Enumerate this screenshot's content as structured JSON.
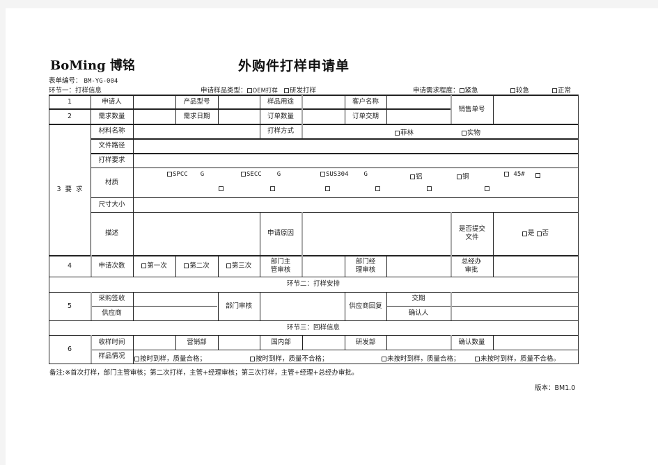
{
  "header": {
    "brand": "BoMing 博铭",
    "title": "外购件打样申请单",
    "form_no_label": "表单编号：",
    "form_no": "BM-YG-004",
    "section1": "环节一：打样信息",
    "sample_type_label": "申请样品类型：",
    "sample_type_options": [
      "OEM打样",
      "研发打样"
    ],
    "urgency_label": "申请需求程度：",
    "urgency_options": [
      "紧急",
      "较急",
      "正常"
    ]
  },
  "rows": {
    "r1": {
      "no": "1",
      "applicant": "申请人",
      "product_model": "产品型号",
      "sample_use": "样品用途",
      "customer_name": "客户名称",
      "sales_no": "销售单号"
    },
    "r2": {
      "no": "2",
      "req_qty": "需求数量",
      "req_date": "需求日期",
      "order_qty": "订单数量",
      "order_delivery": "订单交期"
    },
    "r3": {
      "group_label": "3 要 求",
      "material_name": "材料名称",
      "sampling_method": "打样方式",
      "sampling_options": [
        "菲林",
        "实物"
      ],
      "file_path": "文件路径",
      "sampling_req": "打样要求",
      "material": "材质",
      "materials_line1": [
        {
          "name": "SPCC",
          "unit": "G"
        },
        {
          "name": "SECC",
          "unit": "G"
        },
        {
          "name": "SUS304",
          "unit": "G"
        },
        {
          "name": "铝",
          "unit": ""
        },
        {
          "name": "铜",
          "unit": ""
        },
        {
          "name": " 45#",
          "unit": ""
        }
      ],
      "size": "尺寸大小",
      "description": "描述",
      "reason": "申请原因",
      "submit_file": "是否提交文件",
      "submit_yes": "是",
      "submit_no": "否"
    },
    "r4": {
      "no": "4",
      "times_label": "申请次数",
      "times_options": [
        "第一次",
        "第二次",
        "第三次"
      ],
      "dept_supervisor": "部门主管审核",
      "dept_manager": "部门经理审核",
      "gm_office": "总经办审批"
    },
    "section2": "环节二：打样安排",
    "r5": {
      "no": "5",
      "purchase_sign": "采购签收",
      "supplier": "供应商",
      "dept_review": "部门审核",
      "supplier_reply": "供应商回复",
      "delivery": "交期",
      "confirmer": "确认人"
    },
    "section3": "环节三：回样信息",
    "r6": {
      "no": "6",
      "receive_time": "收样时间",
      "marketing": "营销部",
      "domestic": "国内部",
      "rnd": "研发部",
      "confirm_qty": "确认数量",
      "sample_status": "样品情况",
      "status_options": [
        "按时到样，质量合格；",
        "按时到样，质量不合格；",
        "未按时到样，质量合格；",
        "未按时到样，质量不合格。"
      ]
    }
  },
  "footer": {
    "note": "备注:※首次打样，部门主管审核；第二次打样，主管+经理审核；第三次打样，主管+经理+总经办审批。",
    "version": "版本：BM1.0"
  }
}
